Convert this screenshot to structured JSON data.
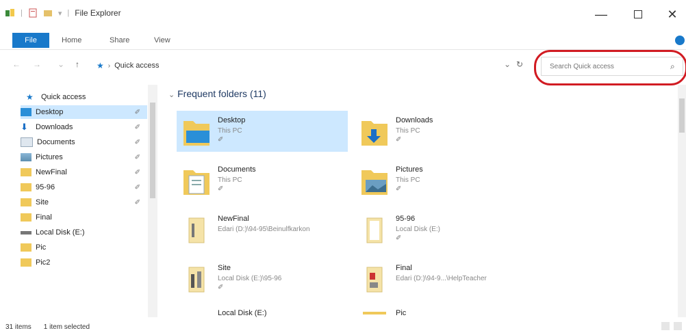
{
  "window": {
    "title": "File Explorer"
  },
  "ribbon": {
    "tabs": [
      "File",
      "Home",
      "Share",
      "View"
    ]
  },
  "address": {
    "path": "Quick access",
    "refresh_glyph": "↻"
  },
  "search": {
    "placeholder": "Search Quick access"
  },
  "navpane": {
    "items": [
      {
        "label": "Quick access",
        "icon": "star-icon",
        "pinned": false
      },
      {
        "label": "Desktop",
        "icon": "desktop-folder-icon",
        "pinned": true
      },
      {
        "label": "Downloads",
        "icon": "downloads-icon",
        "pinned": true
      },
      {
        "label": "Documents",
        "icon": "documents-icon",
        "pinned": true
      },
      {
        "label": "Pictures",
        "icon": "pictures-icon",
        "pinned": true
      },
      {
        "label": "NewFinal",
        "icon": "folder-icon",
        "pinned": true
      },
      {
        "label": "95-96",
        "icon": "folder-icon",
        "pinned": true
      },
      {
        "label": "Site",
        "icon": "folder-icon",
        "pinned": true
      },
      {
        "label": "Final",
        "icon": "folder-icon",
        "pinned": false
      },
      {
        "label": "Local Disk (E:)",
        "icon": "drive-icon",
        "pinned": false
      },
      {
        "label": "Pic",
        "icon": "folder-icon",
        "pinned": false
      },
      {
        "label": "Pic2",
        "icon": "folder-icon",
        "pinned": false
      }
    ]
  },
  "main": {
    "section_title": "Frequent folders (11)",
    "tiles": [
      {
        "name": "Desktop",
        "sub": "This PC",
        "icon": "desktop-folder-icon",
        "pinned": true
      },
      {
        "name": "Downloads",
        "sub": "This PC",
        "icon": "downloads-folder-icon",
        "pinned": true
      },
      {
        "name": "Documents",
        "sub": "This PC",
        "icon": "documents-folder-icon",
        "pinned": true
      },
      {
        "name": "Pictures",
        "sub": "This PC",
        "icon": "pictures-folder-icon",
        "pinned": true
      },
      {
        "name": "NewFinal",
        "sub": "Edari (D:)\\94-95\\Beinulfkarkon",
        "icon": "folder-icon",
        "pinned": false
      },
      {
        "name": "95-96",
        "sub": "Local Disk (E:)",
        "icon": "folder-icon",
        "pinned": true
      },
      {
        "name": "Site",
        "sub": "Local Disk (E:)\\95-96",
        "icon": "folder-icon",
        "pinned": true
      },
      {
        "name": "Final",
        "sub": "Edari (D:)\\94-9...\\HelpTeacher",
        "icon": "folder-icon",
        "pinned": false
      },
      {
        "name": "Local Disk (E:)",
        "sub": "",
        "icon": "drive-icon",
        "pinned": false
      },
      {
        "name": "Pic",
        "sub": "",
        "icon": "folder-icon",
        "pinned": false
      }
    ],
    "pin_glyph": "✐"
  },
  "status": {
    "items_count": "31 items",
    "selection": "1 item selected"
  },
  "colors": {
    "accent": "#1979ca",
    "selected": "#cde8ff",
    "highlight_ring": "#d11b22"
  }
}
